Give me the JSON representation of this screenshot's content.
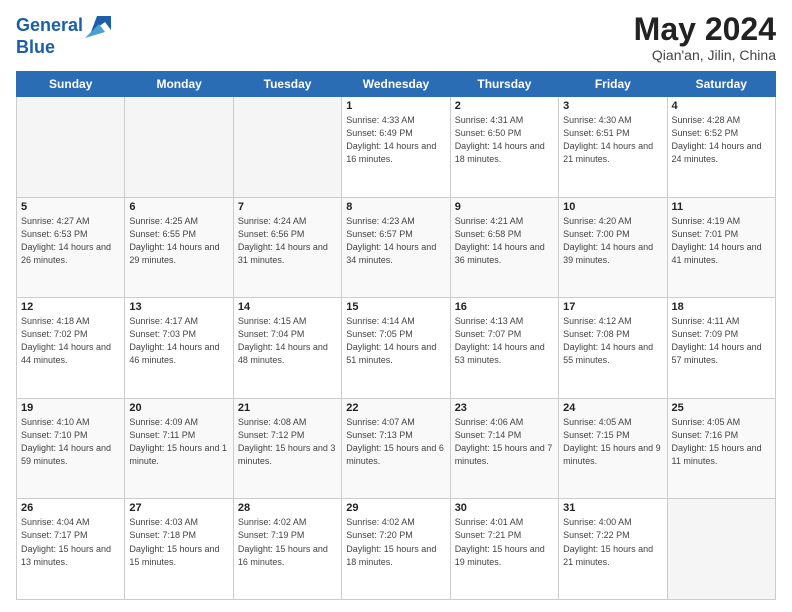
{
  "header": {
    "logo_line1": "General",
    "logo_line2": "Blue",
    "month": "May 2024",
    "location": "Qian'an, Jilin, China"
  },
  "days_of_week": [
    "Sunday",
    "Monday",
    "Tuesday",
    "Wednesday",
    "Thursday",
    "Friday",
    "Saturday"
  ],
  "weeks": [
    [
      {
        "day": "",
        "empty": true
      },
      {
        "day": "",
        "empty": true
      },
      {
        "day": "",
        "empty": true
      },
      {
        "day": "1",
        "sunrise": "4:33 AM",
        "sunset": "6:49 PM",
        "daylight": "14 hours and 16 minutes."
      },
      {
        "day": "2",
        "sunrise": "4:31 AM",
        "sunset": "6:50 PM",
        "daylight": "14 hours and 18 minutes."
      },
      {
        "day": "3",
        "sunrise": "4:30 AM",
        "sunset": "6:51 PM",
        "daylight": "14 hours and 21 minutes."
      },
      {
        "day": "4",
        "sunrise": "4:28 AM",
        "sunset": "6:52 PM",
        "daylight": "14 hours and 24 minutes."
      }
    ],
    [
      {
        "day": "5",
        "sunrise": "4:27 AM",
        "sunset": "6:53 PM",
        "daylight": "14 hours and 26 minutes."
      },
      {
        "day": "6",
        "sunrise": "4:25 AM",
        "sunset": "6:55 PM",
        "daylight": "14 hours and 29 minutes."
      },
      {
        "day": "7",
        "sunrise": "4:24 AM",
        "sunset": "6:56 PM",
        "daylight": "14 hours and 31 minutes."
      },
      {
        "day": "8",
        "sunrise": "4:23 AM",
        "sunset": "6:57 PM",
        "daylight": "14 hours and 34 minutes."
      },
      {
        "day": "9",
        "sunrise": "4:21 AM",
        "sunset": "6:58 PM",
        "daylight": "14 hours and 36 minutes."
      },
      {
        "day": "10",
        "sunrise": "4:20 AM",
        "sunset": "7:00 PM",
        "daylight": "14 hours and 39 minutes."
      },
      {
        "day": "11",
        "sunrise": "4:19 AM",
        "sunset": "7:01 PM",
        "daylight": "14 hours and 41 minutes."
      }
    ],
    [
      {
        "day": "12",
        "sunrise": "4:18 AM",
        "sunset": "7:02 PM",
        "daylight": "14 hours and 44 minutes."
      },
      {
        "day": "13",
        "sunrise": "4:17 AM",
        "sunset": "7:03 PM",
        "daylight": "14 hours and 46 minutes."
      },
      {
        "day": "14",
        "sunrise": "4:15 AM",
        "sunset": "7:04 PM",
        "daylight": "14 hours and 48 minutes."
      },
      {
        "day": "15",
        "sunrise": "4:14 AM",
        "sunset": "7:05 PM",
        "daylight": "14 hours and 51 minutes."
      },
      {
        "day": "16",
        "sunrise": "4:13 AM",
        "sunset": "7:07 PM",
        "daylight": "14 hours and 53 minutes."
      },
      {
        "day": "17",
        "sunrise": "4:12 AM",
        "sunset": "7:08 PM",
        "daylight": "14 hours and 55 minutes."
      },
      {
        "day": "18",
        "sunrise": "4:11 AM",
        "sunset": "7:09 PM",
        "daylight": "14 hours and 57 minutes."
      }
    ],
    [
      {
        "day": "19",
        "sunrise": "4:10 AM",
        "sunset": "7:10 PM",
        "daylight": "14 hours and 59 minutes."
      },
      {
        "day": "20",
        "sunrise": "4:09 AM",
        "sunset": "7:11 PM",
        "daylight": "15 hours and 1 minute."
      },
      {
        "day": "21",
        "sunrise": "4:08 AM",
        "sunset": "7:12 PM",
        "daylight": "15 hours and 3 minutes."
      },
      {
        "day": "22",
        "sunrise": "4:07 AM",
        "sunset": "7:13 PM",
        "daylight": "15 hours and 6 minutes."
      },
      {
        "day": "23",
        "sunrise": "4:06 AM",
        "sunset": "7:14 PM",
        "daylight": "15 hours and 7 minutes."
      },
      {
        "day": "24",
        "sunrise": "4:05 AM",
        "sunset": "7:15 PM",
        "daylight": "15 hours and 9 minutes."
      },
      {
        "day": "25",
        "sunrise": "4:05 AM",
        "sunset": "7:16 PM",
        "daylight": "15 hours and 11 minutes."
      }
    ],
    [
      {
        "day": "26",
        "sunrise": "4:04 AM",
        "sunset": "7:17 PM",
        "daylight": "15 hours and 13 minutes."
      },
      {
        "day": "27",
        "sunrise": "4:03 AM",
        "sunset": "7:18 PM",
        "daylight": "15 hours and 15 minutes."
      },
      {
        "day": "28",
        "sunrise": "4:02 AM",
        "sunset": "7:19 PM",
        "daylight": "15 hours and 16 minutes."
      },
      {
        "day": "29",
        "sunrise": "4:02 AM",
        "sunset": "7:20 PM",
        "daylight": "15 hours and 18 minutes."
      },
      {
        "day": "30",
        "sunrise": "4:01 AM",
        "sunset": "7:21 PM",
        "daylight": "15 hours and 19 minutes."
      },
      {
        "day": "31",
        "sunrise": "4:00 AM",
        "sunset": "7:22 PM",
        "daylight": "15 hours and 21 minutes."
      },
      {
        "day": "",
        "empty": true
      }
    ]
  ],
  "labels": {
    "sunrise_prefix": "Sunrise: ",
    "sunset_prefix": "Sunset: ",
    "daylight_prefix": "Daylight: "
  }
}
